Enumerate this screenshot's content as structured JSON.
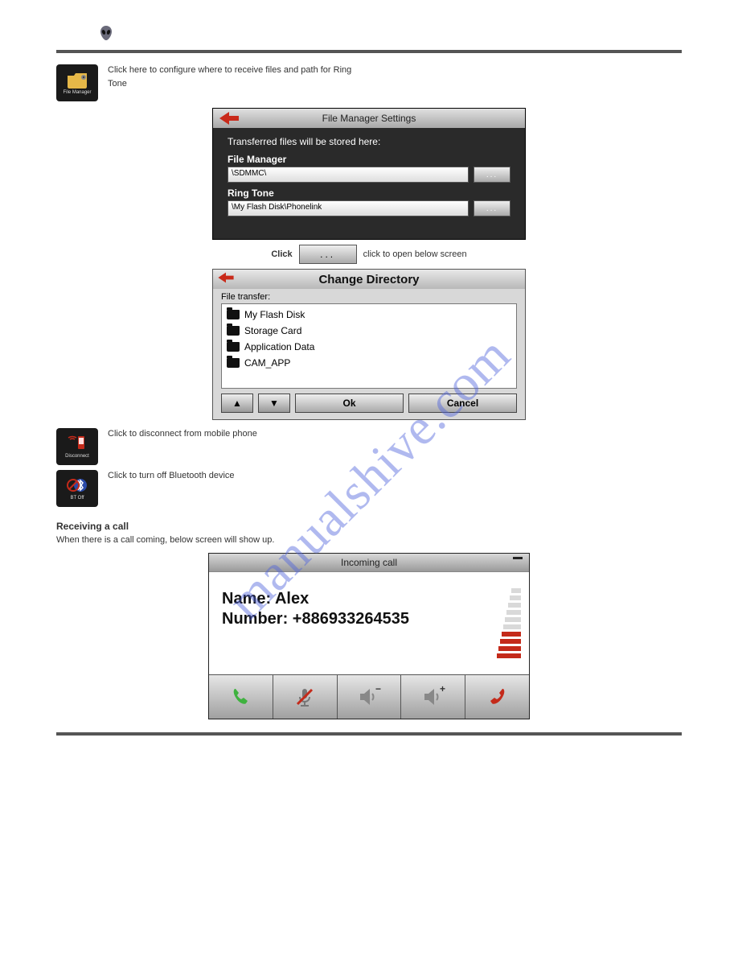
{
  "header": {
    "icon": "alien-head-icon"
  },
  "file_manager_thumb": {
    "label": "File Manager"
  },
  "caption_fm_1": "Click here to configure where to receive files and path for Ring",
  "caption_fm_2": "Tone",
  "fm_panel": {
    "title": "File Manager Settings",
    "header_text": "Transferred files will be stored here:",
    "field1_label": "File Manager",
    "field1_value": "\\SDMMC\\",
    "field1_btn": "...",
    "field2_label": "Ring Tone",
    "field2_value": "\\My Flash Disk\\Phonelink",
    "field2_btn": "..."
  },
  "lone_btn": {
    "label": "...",
    "caption": "click to open below screen"
  },
  "cd_panel": {
    "title": "Change Directory",
    "subtitle": "File transfer:",
    "items": [
      "My Flash Disk",
      "Storage Card",
      "Application Data",
      "CAM_APP"
    ],
    "ok": "Ok",
    "cancel": "Cancel"
  },
  "disconnect_thumb": {
    "label": "Disconnect",
    "caption": "Click to disconnect from mobile phone"
  },
  "btoff_thumb": {
    "label": "BT Off",
    "caption": "Click to turn off Bluetooth device"
  },
  "section_title": "Receiving a call",
  "section_body": "When there is a call coming, below screen will show up.",
  "call_panel": {
    "title": "Incoming call",
    "name_label": "Name:",
    "name_value": "Alex",
    "number_label": "Number:",
    "number_value": "+886933264535",
    "signal_levels": [
      false,
      false,
      false,
      false,
      false,
      false,
      true,
      true,
      true,
      true
    ],
    "buttons": [
      "answer",
      "mute",
      "volume-down",
      "volume-up",
      "reject"
    ]
  },
  "watermark": "manualshive.com"
}
